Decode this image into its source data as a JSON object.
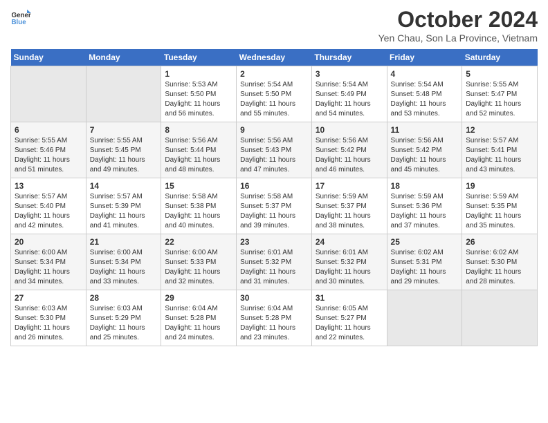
{
  "header": {
    "logo_line1": "General",
    "logo_line2": "Blue",
    "month": "October 2024",
    "location": "Yen Chau, Son La Province, Vietnam"
  },
  "weekdays": [
    "Sunday",
    "Monday",
    "Tuesday",
    "Wednesday",
    "Thursday",
    "Friday",
    "Saturday"
  ],
  "weeks": [
    [
      {
        "day": "",
        "info": ""
      },
      {
        "day": "",
        "info": ""
      },
      {
        "day": "1",
        "info": "Sunrise: 5:53 AM\nSunset: 5:50 PM\nDaylight: 11 hours and 56 minutes."
      },
      {
        "day": "2",
        "info": "Sunrise: 5:54 AM\nSunset: 5:50 PM\nDaylight: 11 hours and 55 minutes."
      },
      {
        "day": "3",
        "info": "Sunrise: 5:54 AM\nSunset: 5:49 PM\nDaylight: 11 hours and 54 minutes."
      },
      {
        "day": "4",
        "info": "Sunrise: 5:54 AM\nSunset: 5:48 PM\nDaylight: 11 hours and 53 minutes."
      },
      {
        "day": "5",
        "info": "Sunrise: 5:55 AM\nSunset: 5:47 PM\nDaylight: 11 hours and 52 minutes."
      }
    ],
    [
      {
        "day": "6",
        "info": "Sunrise: 5:55 AM\nSunset: 5:46 PM\nDaylight: 11 hours and 51 minutes."
      },
      {
        "day": "7",
        "info": "Sunrise: 5:55 AM\nSunset: 5:45 PM\nDaylight: 11 hours and 49 minutes."
      },
      {
        "day": "8",
        "info": "Sunrise: 5:56 AM\nSunset: 5:44 PM\nDaylight: 11 hours and 48 minutes."
      },
      {
        "day": "9",
        "info": "Sunrise: 5:56 AM\nSunset: 5:43 PM\nDaylight: 11 hours and 47 minutes."
      },
      {
        "day": "10",
        "info": "Sunrise: 5:56 AM\nSunset: 5:42 PM\nDaylight: 11 hours and 46 minutes."
      },
      {
        "day": "11",
        "info": "Sunrise: 5:56 AM\nSunset: 5:42 PM\nDaylight: 11 hours and 45 minutes."
      },
      {
        "day": "12",
        "info": "Sunrise: 5:57 AM\nSunset: 5:41 PM\nDaylight: 11 hours and 43 minutes."
      }
    ],
    [
      {
        "day": "13",
        "info": "Sunrise: 5:57 AM\nSunset: 5:40 PM\nDaylight: 11 hours and 42 minutes."
      },
      {
        "day": "14",
        "info": "Sunrise: 5:57 AM\nSunset: 5:39 PM\nDaylight: 11 hours and 41 minutes."
      },
      {
        "day": "15",
        "info": "Sunrise: 5:58 AM\nSunset: 5:38 PM\nDaylight: 11 hours and 40 minutes."
      },
      {
        "day": "16",
        "info": "Sunrise: 5:58 AM\nSunset: 5:37 PM\nDaylight: 11 hours and 39 minutes."
      },
      {
        "day": "17",
        "info": "Sunrise: 5:59 AM\nSunset: 5:37 PM\nDaylight: 11 hours and 38 minutes."
      },
      {
        "day": "18",
        "info": "Sunrise: 5:59 AM\nSunset: 5:36 PM\nDaylight: 11 hours and 37 minutes."
      },
      {
        "day": "19",
        "info": "Sunrise: 5:59 AM\nSunset: 5:35 PM\nDaylight: 11 hours and 35 minutes."
      }
    ],
    [
      {
        "day": "20",
        "info": "Sunrise: 6:00 AM\nSunset: 5:34 PM\nDaylight: 11 hours and 34 minutes."
      },
      {
        "day": "21",
        "info": "Sunrise: 6:00 AM\nSunset: 5:34 PM\nDaylight: 11 hours and 33 minutes."
      },
      {
        "day": "22",
        "info": "Sunrise: 6:00 AM\nSunset: 5:33 PM\nDaylight: 11 hours and 32 minutes."
      },
      {
        "day": "23",
        "info": "Sunrise: 6:01 AM\nSunset: 5:32 PM\nDaylight: 11 hours and 31 minutes."
      },
      {
        "day": "24",
        "info": "Sunrise: 6:01 AM\nSunset: 5:32 PM\nDaylight: 11 hours and 30 minutes."
      },
      {
        "day": "25",
        "info": "Sunrise: 6:02 AM\nSunset: 5:31 PM\nDaylight: 11 hours and 29 minutes."
      },
      {
        "day": "26",
        "info": "Sunrise: 6:02 AM\nSunset: 5:30 PM\nDaylight: 11 hours and 28 minutes."
      }
    ],
    [
      {
        "day": "27",
        "info": "Sunrise: 6:03 AM\nSunset: 5:30 PM\nDaylight: 11 hours and 26 minutes."
      },
      {
        "day": "28",
        "info": "Sunrise: 6:03 AM\nSunset: 5:29 PM\nDaylight: 11 hours and 25 minutes."
      },
      {
        "day": "29",
        "info": "Sunrise: 6:04 AM\nSunset: 5:28 PM\nDaylight: 11 hours and 24 minutes."
      },
      {
        "day": "30",
        "info": "Sunrise: 6:04 AM\nSunset: 5:28 PM\nDaylight: 11 hours and 23 minutes."
      },
      {
        "day": "31",
        "info": "Sunrise: 6:05 AM\nSunset: 5:27 PM\nDaylight: 11 hours and 22 minutes."
      },
      {
        "day": "",
        "info": ""
      },
      {
        "day": "",
        "info": ""
      }
    ]
  ]
}
